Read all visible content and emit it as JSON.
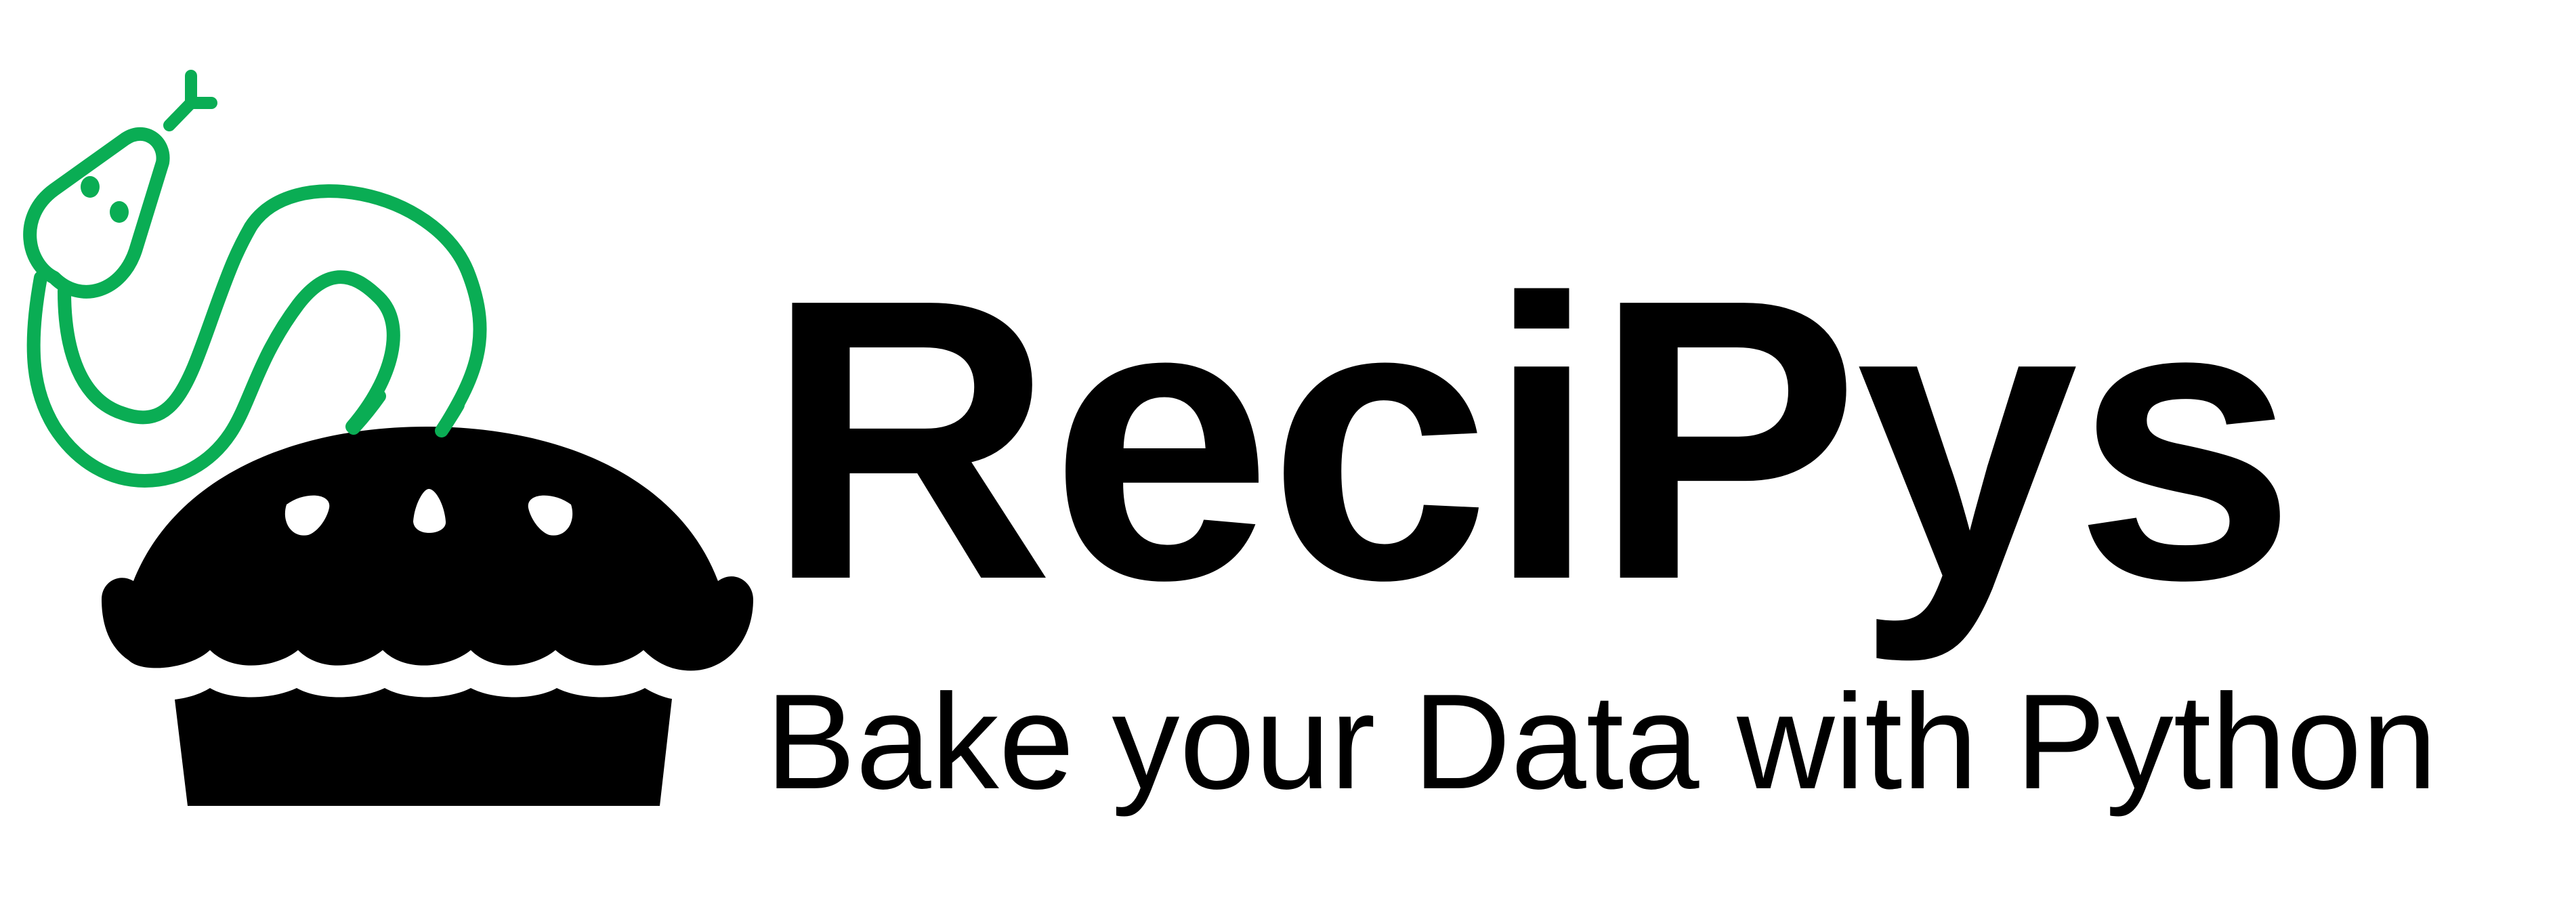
{
  "brand": {
    "name": "ReciPys",
    "tagline": "Bake your Data with Python"
  },
  "colors": {
    "snake": "#0aad54",
    "pie": "#000000",
    "text": "#000000",
    "background": "#ffffff"
  },
  "icons": {
    "logo": "snake-in-pie-icon"
  }
}
